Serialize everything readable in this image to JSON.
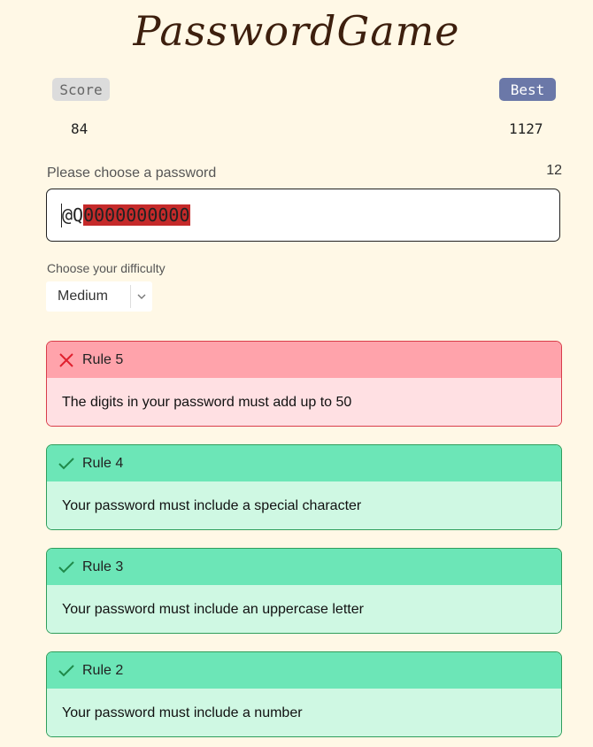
{
  "app": {
    "title": "PasswordGame"
  },
  "score": {
    "label": "Score",
    "value": "84"
  },
  "best": {
    "label": "Best",
    "value": "1127"
  },
  "password": {
    "label": "Please choose a password",
    "length": "12",
    "prefix": "@Q",
    "highlighted": "0000000000"
  },
  "difficulty": {
    "label": "Choose your difficulty",
    "value": "Medium"
  },
  "rules": [
    {
      "title": "Rule 5",
      "text": "The digits in your password must add up to 50",
      "status": "fail"
    },
    {
      "title": "Rule 4",
      "text": "Your password must include a special character",
      "status": "pass"
    },
    {
      "title": "Rule 3",
      "text": "Your password must include an uppercase letter",
      "status": "pass"
    },
    {
      "title": "Rule 2",
      "text": "Your password must include a number",
      "status": "pass"
    }
  ],
  "colors": {
    "background": "#fff8e6",
    "fail_header": "#ffa3ab",
    "pass_header": "#6ce6b7",
    "highlight": "#c52a2a",
    "best_badge": "#6b78a8"
  },
  "icons": {
    "fail": "x-icon",
    "pass": "check-icon",
    "dropdown": "chevron-down-icon"
  }
}
